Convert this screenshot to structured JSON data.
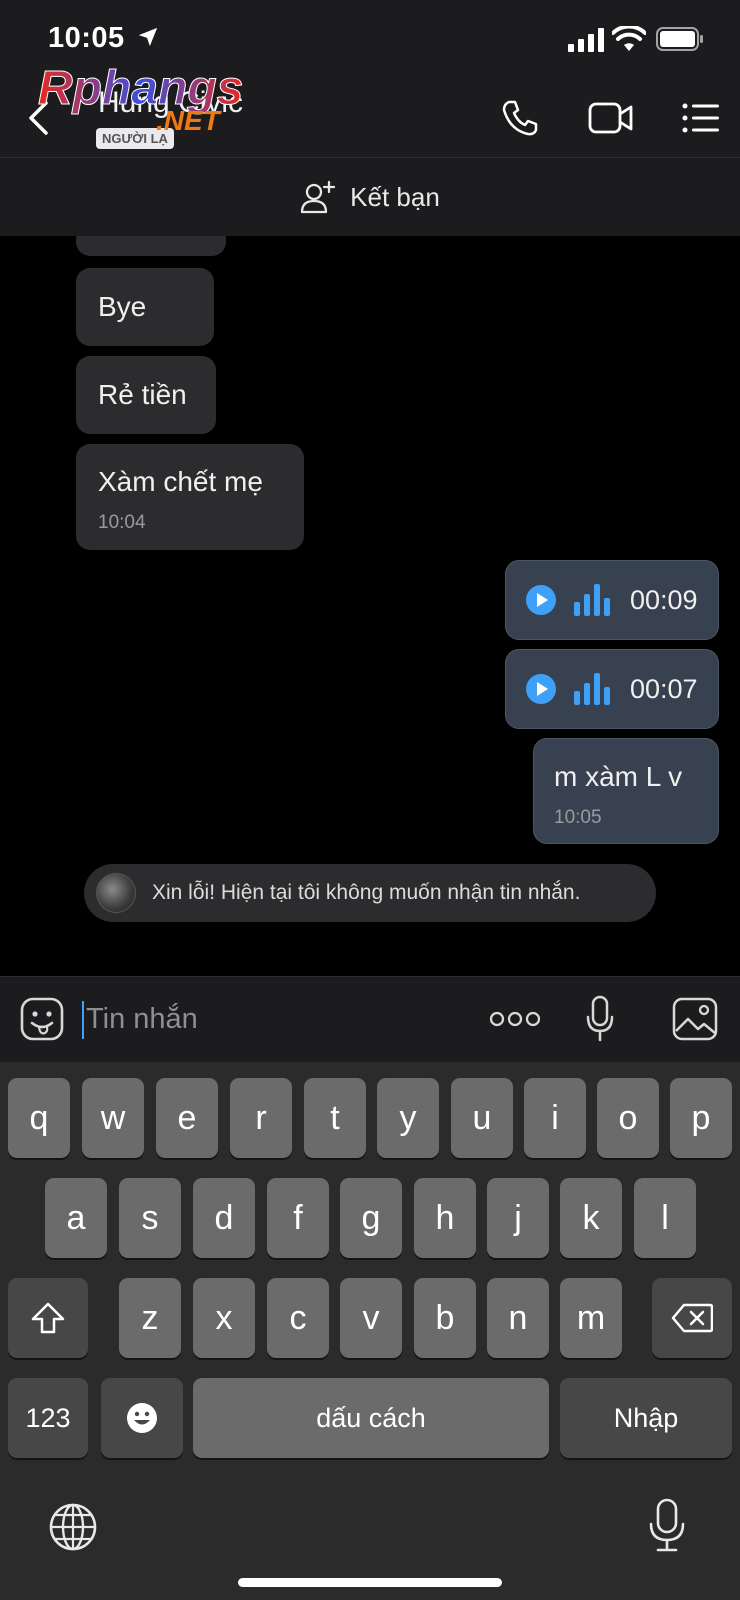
{
  "status": {
    "time": "10:05"
  },
  "header": {
    "contact_name": "Hung Civic",
    "contact_tag": "NGƯỜI LẠ",
    "logo_text_a": "Rphangs",
    "logo_text_b": ".NET"
  },
  "friend_bar": {
    "label": "Kết bạn"
  },
  "messages": {
    "in_1": "Bye",
    "in_2": "Rẻ tiền",
    "in_3": "Xàm chết mẹ",
    "in_3_time": "10:04",
    "voice_1_duration": "00:09",
    "voice_2_duration": "00:07",
    "out_1": "m xàm L v",
    "out_1_time": "10:05"
  },
  "notice": {
    "text": "Xin lỗi! Hiện tại tôi không muốn nhận tin nhắn."
  },
  "input": {
    "placeholder": "Tin nhắn"
  },
  "keyboard": {
    "row1": [
      "q",
      "w",
      "e",
      "r",
      "t",
      "y",
      "u",
      "i",
      "o",
      "p"
    ],
    "row2": [
      "a",
      "s",
      "d",
      "f",
      "g",
      "h",
      "j",
      "k",
      "l"
    ],
    "row3": [
      "z",
      "x",
      "c",
      "v",
      "b",
      "n",
      "m"
    ],
    "numbers_key": "123",
    "space_key": "dấu cách",
    "return_key": "Nhập"
  },
  "colors": {
    "accent": "#3ea0f7",
    "bubble_in": "#2c2c2e",
    "bubble_out": "#37414f"
  }
}
